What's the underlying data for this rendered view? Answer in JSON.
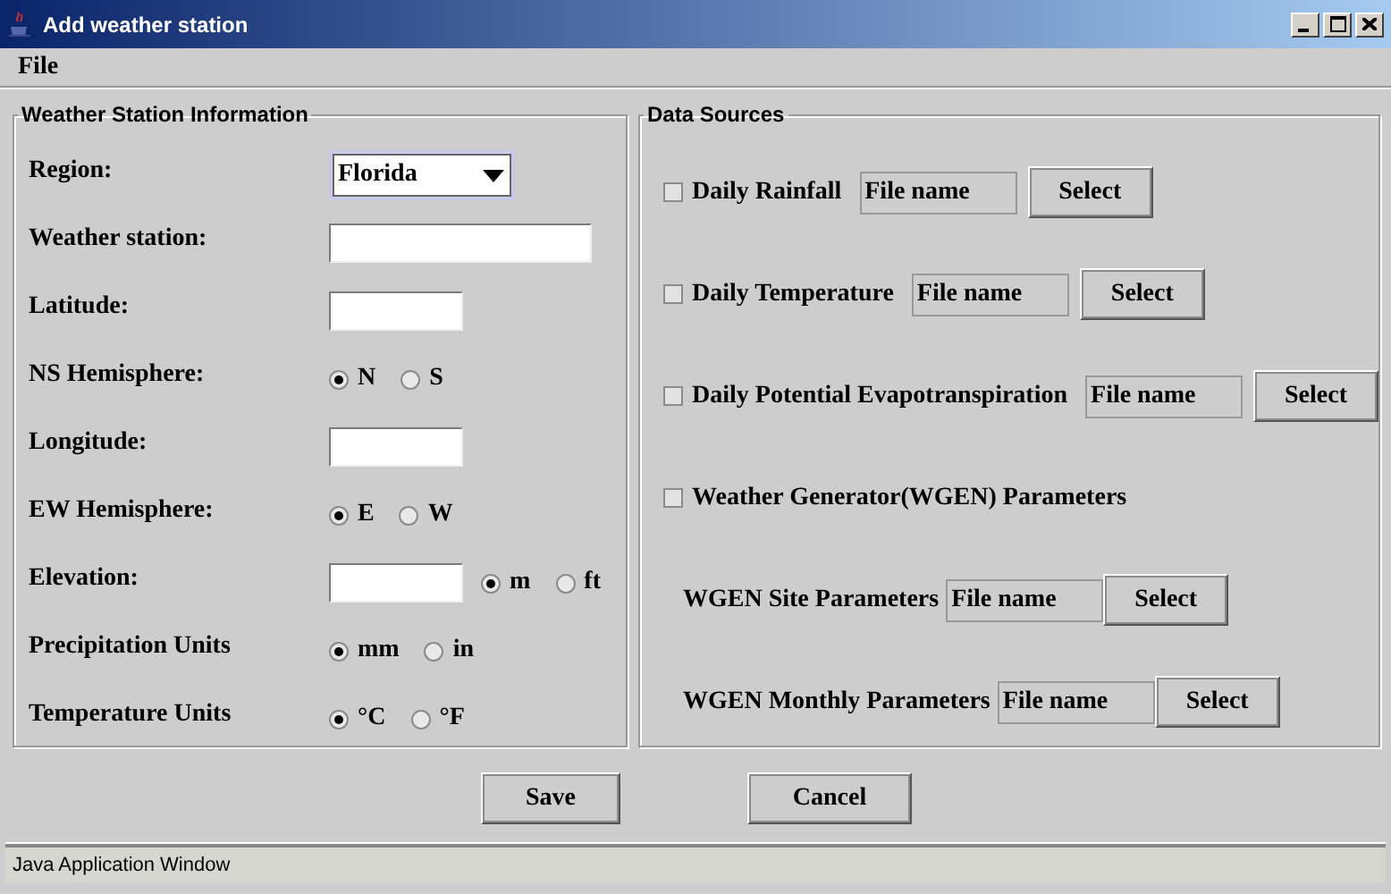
{
  "window": {
    "title": "Add weather station"
  },
  "menu": [
    "File"
  ],
  "station_info": {
    "title": "Weather Station Information",
    "rows": [
      {
        "label": "Region:",
        "controls": [
          {
            "kind": "select",
            "value": "Florida"
          }
        ]
      },
      {
        "label": "Weather station:",
        "controls": [
          {
            "kind": "wide_field"
          }
        ]
      },
      {
        "label": "Latitude:",
        "controls": [
          {
            "kind": "field"
          }
        ]
      },
      {
        "label": "NS Hemisphere:",
        "controls": [
          {
            "kind": "radio",
            "label": "N",
            "selected": true
          },
          {
            "kind": "radio",
            "label": "S",
            "selected": false
          }
        ]
      },
      {
        "label": "Longitude:",
        "controls": [
          {
            "kind": "field"
          }
        ]
      },
      {
        "label": "EW Hemisphere:",
        "controls": [
          {
            "kind": "radio",
            "label": "E",
            "selected": true
          },
          {
            "kind": "radio",
            "label": "W",
            "selected": false
          }
        ]
      },
      {
        "label": "Elevation:",
        "controls": [
          {
            "kind": "field"
          },
          {
            "kind": "radio",
            "label": "m",
            "selected": true
          },
          {
            "kind": "radio",
            "label": "ft",
            "selected": false
          }
        ]
      },
      {
        "label": "Precipitation Units",
        "controls": [
          {
            "kind": "radio",
            "label": "mm",
            "selected": true
          },
          {
            "kind": "radio",
            "label": "in",
            "selected": false
          }
        ]
      },
      {
        "label": "Temperature Units",
        "controls": [
          {
            "kind": "radio",
            "label": "°C",
            "selected": true
          },
          {
            "kind": "radio",
            "label": "°F",
            "selected": false
          }
        ]
      }
    ]
  },
  "data_sources": {
    "title": "Data Sources",
    "rows": [
      {
        "kind": "file",
        "label": "Daily Rainfall",
        "checked": false,
        "value": "File name",
        "button": "Select"
      },
      {
        "kind": "file",
        "label": "Daily Temperature",
        "checked": false,
        "value": "File name",
        "button": "Select"
      },
      {
        "kind": "file",
        "label": "Daily Potential Evapotranspiration",
        "checked": false,
        "value": "File name",
        "button": "Select"
      },
      {
        "kind": "toggle",
        "label": "Weather Generator(WGEN) Parameters",
        "checked": false
      },
      {
        "kind": "subfile",
        "label": "WGEN Site Parameters",
        "value": "File name",
        "button": "Select"
      },
      {
        "kind": "subfile",
        "label": "WGEN Monthly Parameters",
        "value": "File name",
        "button": "Select"
      }
    ]
  },
  "buttons": [
    "Save",
    "Cancel"
  ],
  "status_bar": "Java Application Window"
}
